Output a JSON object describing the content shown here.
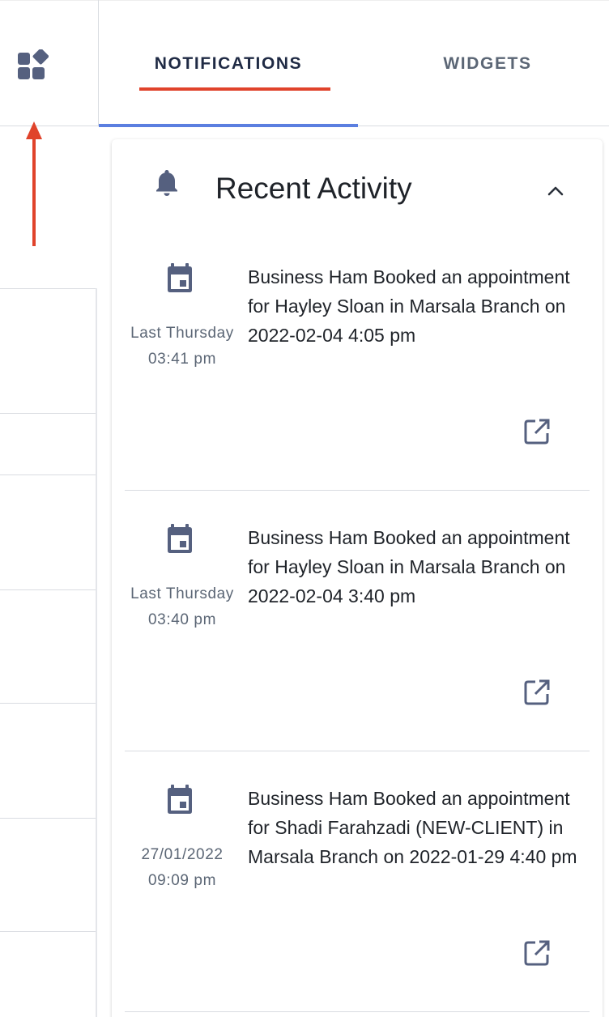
{
  "tabs": {
    "notifications_label": "NOTIFICATIONS",
    "widgets_label": "WIDGETS",
    "active": "notifications"
  },
  "recent_activity": {
    "title": "Recent Activity",
    "items": [
      {
        "date": "Last Thursday",
        "time": "03:41 pm",
        "text": "Business Ham Booked an appointment for Hayley Sloan in Marsala Branch on 2022-02-04 4:05 pm",
        "icon": "calendar-icon"
      },
      {
        "date": "Last Thursday",
        "time": "03:40 pm",
        "text": "Business Ham Booked an appointment for Hayley Sloan in Marsala Branch on 2022-02-04 3:40 pm",
        "icon": "calendar-icon"
      },
      {
        "date": "27/01/2022",
        "time": "09:09 pm",
        "text": "Business Ham Booked an appointment for Shadi Farahzadi (NEW-CLIENT) in Marsala Branch on 2022-01-29 4:40 pm",
        "icon": "calendar-icon"
      }
    ]
  },
  "colors": {
    "accent_red": "#e0432b",
    "accent_blue": "#5b7fe0",
    "icon_slate": "#55607f",
    "text_dark": "#1f2329",
    "text_muted": "#5b6675"
  },
  "icons": {
    "widgets_toggle": "widgets-icon",
    "header": "bell-icon",
    "collapse": "chevron-up-icon",
    "open": "open-in-new-icon"
  }
}
